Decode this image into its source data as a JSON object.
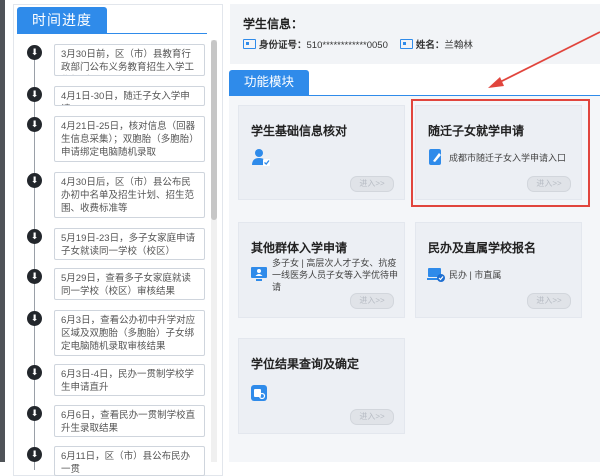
{
  "timeline": {
    "tab_label": "时间进度",
    "dot_icon": "download-icon",
    "items": [
      {
        "text": "3月30日前，区（市）县教育行政部门公布义务教育招生入学工作细则"
      },
      {
        "text": "4月1日-30日，随迁子女入学申请"
      },
      {
        "text": "4月21日-25日，核对信息（回器生信息采集）；双胞胎（多胞胎）申请绑定电脑随机录取"
      },
      {
        "text": "4月30日后，区（市）县公布民办初中名单及招生计划、招生范围、收费标准等"
      },
      {
        "text": "5月19日-23日，多子女家庭申请子女就读同一学校（校区）"
      },
      {
        "text": "5月29日，查看多子女家庭就读同一学校（校区）审核结果"
      },
      {
        "text": "6月3日，查看公办初中升学对应区域及双胞胎（多胞胎）子女绑定电脑随机录取审核结果"
      },
      {
        "text": "6月3日-4日，民办一贯制学校学生申请直升"
      },
      {
        "text": "6月6日，查看民办一贯制学校直升生录取结果"
      },
      {
        "text": "6月11日，区（市）县公布民办一贯"
      }
    ]
  },
  "student_info": {
    "title": "学生信息：",
    "id_label": "身份证号：",
    "id_value": "510************0050",
    "name_label": "姓名：",
    "name_value": "兰翰林"
  },
  "functions": {
    "tab_label": "功能模块",
    "enter_label": "进入>>",
    "modules": [
      {
        "title": "学生基础信息核对",
        "desc": "",
        "icon": "user-check-icon"
      },
      {
        "title": "随迁子女就学申请",
        "desc": "成都市随迁子女入学申请入口",
        "icon": "document-pen-icon"
      },
      {
        "title": "其他群体入学申请",
        "desc": "多子女 | 高层次人才子女、抗疫一线医务人员子女等入学优待申请",
        "icon": "monitor-user-icon"
      },
      {
        "title": "民办及直属学校报名",
        "desc": "民办 | 市直属",
        "icon": "laptop-check-icon"
      },
      {
        "title": "学位结果查询及确定",
        "desc": "",
        "icon": "result-doc-icon"
      }
    ]
  },
  "colors": {
    "accent": "#2f8bea",
    "highlight_box": "#e1453d",
    "arrow": "#e1453d"
  }
}
